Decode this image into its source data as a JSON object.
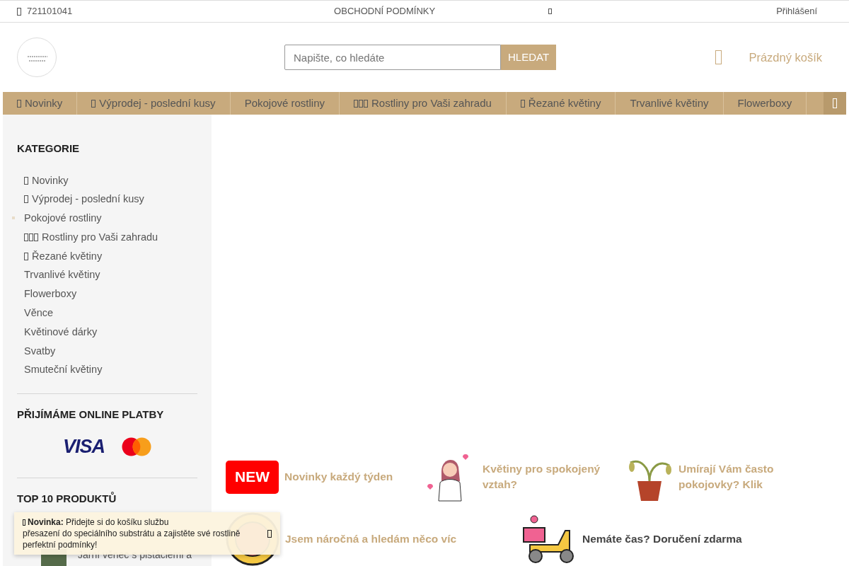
{
  "top_bar": {
    "phone": "721101041",
    "terms_link": "OBCHODNÍ PODMÍNKY",
    "login_link": "Přihlášení"
  },
  "header": {
    "search": {
      "placeholder": "Napište, co hledáte",
      "button": "HLEDAT"
    },
    "cart": "Prázdný košík"
  },
  "nav": [
    {
      "label": "Novinky",
      "kind": "icon"
    },
    {
      "label": "Výprodej - poslední kusy",
      "kind": "icon"
    },
    {
      "label": "Pokojové rostliny",
      "kind": "plain"
    },
    {
      "label": "Rostliny pro Vaši zahradu",
      "kind": "triple"
    },
    {
      "label": "Řezané květiny",
      "kind": "icon"
    },
    {
      "label": "Trvanlivé květiny",
      "kind": "plain"
    },
    {
      "label": "Flowerboxy",
      "kind": "plain"
    }
  ],
  "sidebar": {
    "categories_title": "KATEGORIE",
    "categories": [
      {
        "label": "Novinky",
        "kind": "icon",
        "selected": false
      },
      {
        "label": "Výprodej - poslední kusy",
        "kind": "icon",
        "selected": false
      },
      {
        "label": "Pokojové rostliny",
        "kind": "plain",
        "selected": true
      },
      {
        "label": "Rostliny pro Vaši zahradu",
        "kind": "triple",
        "selected": false
      },
      {
        "label": "Řezané květiny",
        "kind": "icon",
        "selected": false
      },
      {
        "label": "Trvanlivé květiny",
        "kind": "plain",
        "selected": false
      },
      {
        "label": "Flowerboxy",
        "kind": "plain",
        "selected": false
      },
      {
        "label": "Věnce",
        "kind": "plain",
        "selected": false
      },
      {
        "label": "Květinové dárky",
        "kind": "plain",
        "selected": false
      },
      {
        "label": "Svatby",
        "kind": "plain",
        "selected": false
      },
      {
        "label": "Smuteční květiny",
        "kind": "plain",
        "selected": false
      }
    ],
    "payments_title": "PŘIJÍMÁME ONLINE PLATBY",
    "visa": "VISA",
    "top_title": "TOP 10 PRODUKTŮ",
    "products": [
      {
        "name": "Jarní věnec s pistáciemi a"
      }
    ]
  },
  "features": [
    {
      "kind": "new",
      "badge": "NEW",
      "text": "Novinky každý týden",
      "color": "#c8aa7d"
    },
    {
      "kind": "girl",
      "text": "Květiny pro spokojený vztah?",
      "color": "#c8aa7d"
    },
    {
      "kind": "plant",
      "text": "Umírají Vám často pokojovky? Klik",
      "color": "#c8aa7d"
    },
    {
      "kind": "exclusive",
      "text": "Jsem náročná a hledám něco víc",
      "color": "#c8aa7d"
    },
    {
      "kind": "scooter",
      "text": "Nemáte čas? Doručení zdarma",
      "color": "#444444"
    }
  ],
  "notice": {
    "title": "Novinka:",
    "text_before": "Přidejte si do košíku službu",
    "link": "přesazení do speciálního substrátu",
    "text_after": "a zajistěte své rostlině perfektní podmínky!"
  }
}
